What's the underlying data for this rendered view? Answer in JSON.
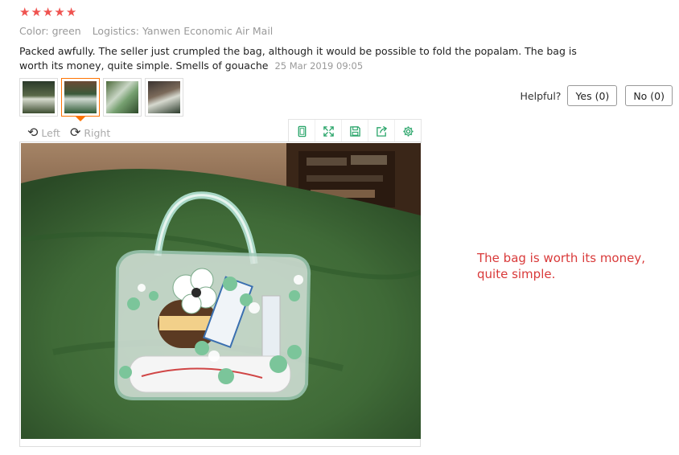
{
  "rating": {
    "stars": 5,
    "star_glyph": "★",
    "color": "#ef5350"
  },
  "meta": {
    "color": "Color: green",
    "logistics": "Logistics: Yanwen Economic Air Mail"
  },
  "review": {
    "text": "Packed awfully. The seller just crumpled the bag, although it would be possible to fold the popalam. The bag is worth its money, quite simple. Smells of gouache",
    "date": "25 Mar 2019 09:05"
  },
  "thumbnails": {
    "count": 4,
    "active_index": 1,
    "active_color": "#ff7300"
  },
  "rotate": {
    "left_label": "Left",
    "right_label": "Right"
  },
  "toolbar": {
    "icons": [
      "fit-icon",
      "expand-icon",
      "save-icon",
      "share-icon",
      "settings-icon"
    ],
    "accent": "#2aa56a"
  },
  "helpful": {
    "label": "Helpful?",
    "yes": "Yes (0)",
    "no": "No (0)"
  },
  "annotation": {
    "text": "The bag is worth its money, quite simple."
  }
}
